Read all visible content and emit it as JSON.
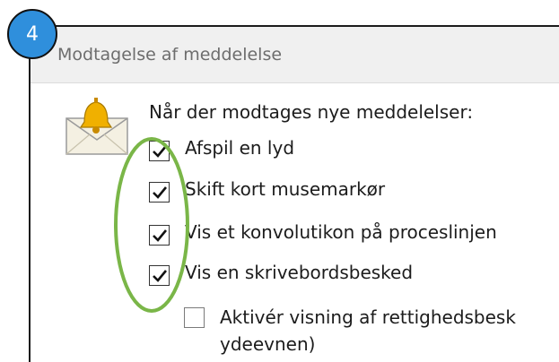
{
  "badge": {
    "number": "4"
  },
  "section": {
    "title": "Modtagelse af meddelelse"
  },
  "intro": "Når der modtages nye meddelelser:",
  "options": [
    {
      "label": "Afspil en lyd",
      "checked": true
    },
    {
      "label": "Skift kort musemarkør",
      "checked": true
    },
    {
      "label": "Vis et konvolutikon på proceslinjen",
      "checked": true
    },
    {
      "label": "Vis en skrivebordsbesked",
      "checked": true
    }
  ],
  "sub_option": {
    "label_line1": "Aktivér visning af rettighedsbesk",
    "label_line2": "ydeevnen)",
    "checked": false
  },
  "colors": {
    "badge": "#2f8fdc",
    "highlight": "#7ab648",
    "bell": "#f0b000",
    "header_bg": "#f0f0f0"
  },
  "icons": {
    "mail": "bell-envelope-icon",
    "check": "checkmark-icon"
  }
}
